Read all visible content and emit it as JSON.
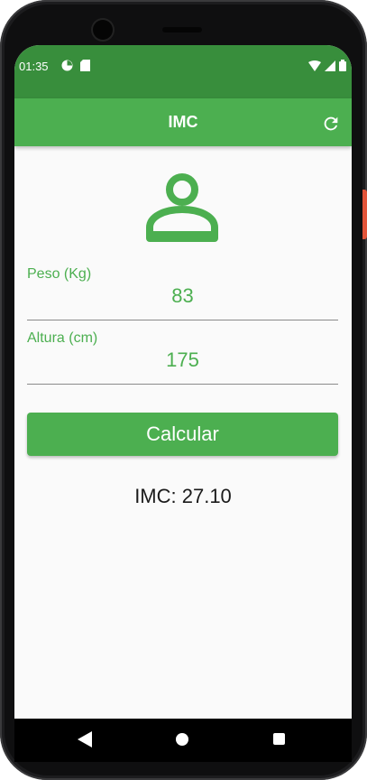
{
  "status_bar": {
    "time": "01:35",
    "background": "#388e3c",
    "left_icons": [
      "app-notification-icon",
      "sd-card-icon"
    ],
    "right_icons": [
      "wifi-icon",
      "signal-icon",
      "battery-icon"
    ]
  },
  "app_bar": {
    "title": "IMC",
    "background": "#4caf50",
    "actions": [
      "refresh-icon"
    ]
  },
  "header_icon": "person-icon",
  "form": {
    "weight": {
      "label": "Peso (Kg)",
      "value": "83"
    },
    "height": {
      "label": "Altura (cm)",
      "value": "175"
    }
  },
  "calculate_button": {
    "label": "Calcular"
  },
  "result": {
    "text": "IMC: 27.10"
  },
  "nav_bar": {
    "icons": [
      "back-icon",
      "home-icon",
      "recents-icon"
    ]
  },
  "colors": {
    "accent": "#4caf50",
    "accent_dark": "#388e3c",
    "background": "#fafafa"
  }
}
